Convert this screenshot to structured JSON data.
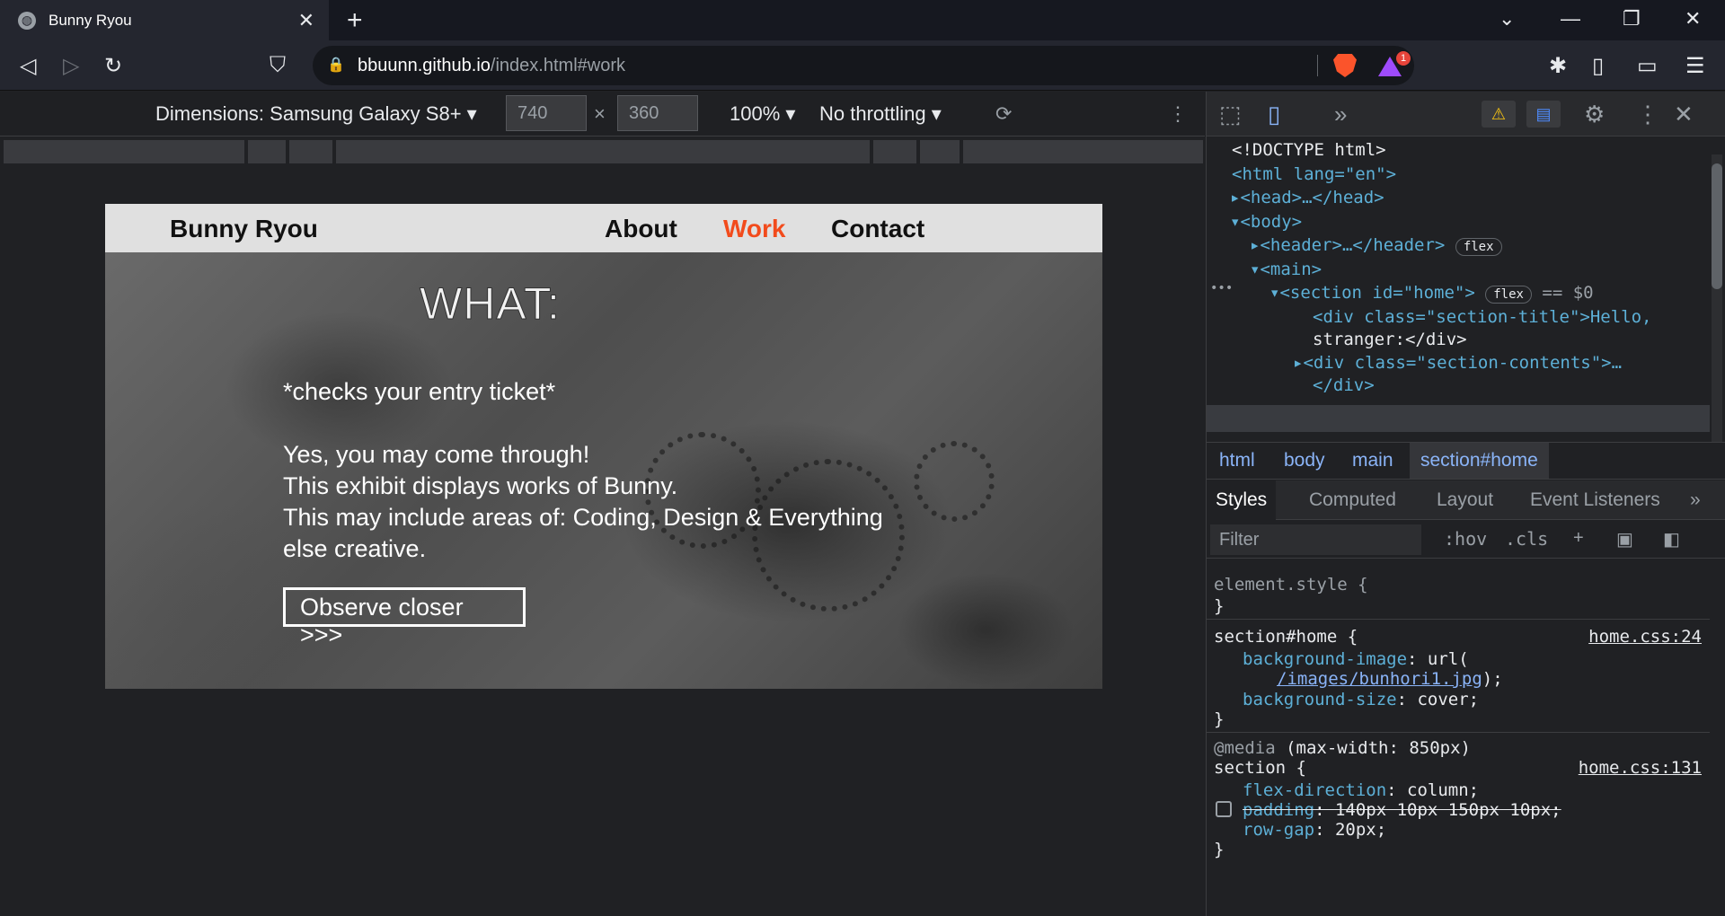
{
  "browser": {
    "tab_title": "Bunny Ryou",
    "url_host": "bbuunn.github.io",
    "url_rest": "/index.html#work",
    "shields_count": "1"
  },
  "device_toolbar": {
    "dimensions_label": "Dimensions: Samsung Galaxy S8+",
    "width": "740",
    "height": "360",
    "times": "×",
    "zoom": "100%",
    "throttling": "No throttling"
  },
  "site": {
    "brand": "Bunny Ryou",
    "nav": [
      "About",
      "Work",
      "Contact"
    ],
    "active_nav": "Work",
    "hero_title": "WHAT:",
    "line1": "*checks your entry ticket*",
    "line2": "Yes, you may come through!",
    "line3": "This exhibit displays works of Bunny.",
    "line4": "This may include areas of: Coding, Design & Everything",
    "line5": "else creative.",
    "button": "Observe closer >>>"
  },
  "devtools": {
    "dom": {
      "doctype": "<!DOCTYPE html>",
      "html_open": "<html lang=\"en\">",
      "head": "<head>…</head>",
      "body_open": "<body>",
      "header": "<header>…</header>",
      "main_open": "<main>",
      "section_open": "<section id=\"home\">",
      "section_suffix": "== $0",
      "div_title": "<div class=\"section-title\">Hello,",
      "div_title_cont": "stranger:</div>",
      "div_contents": "<div class=\"section-contents\">…",
      "div_contents_cont": "</div>",
      "pill": "flex",
      "ellipsis": "•••"
    },
    "breadcrumbs": [
      "html",
      "body",
      "main",
      "section#home"
    ],
    "style_tabs": [
      "Styles",
      "Computed",
      "Layout",
      "Event Listeners"
    ],
    "filter_placeholder": "Filter",
    "hov": ":hov",
    "cls": ".cls",
    "rules": {
      "element_style": "element.style {",
      "close": "}",
      "r1_selector": "section#home {",
      "r1_source": "home.css:24",
      "r1_p1_name": "background-image",
      "r1_p1_val": "url(",
      "r1_p1_link": "/images/bunhori1.jpg",
      "r1_p1_end": ");",
      "r1_p2_name": "background-size",
      "r1_p2_val": "cover;",
      "media": "@media",
      "media_cond": "(max-width: 850px)",
      "r2_selector": "section {",
      "r2_source": "home.css:131",
      "r2_p1_name": "flex-direction",
      "r2_p1_val": "column;",
      "r2_p2_name": "padding",
      "r2_p2_val": "140px 10px 150px 10px;",
      "r2_p3_name": "row-gap",
      "r2_p3_val": "20px;"
    }
  }
}
